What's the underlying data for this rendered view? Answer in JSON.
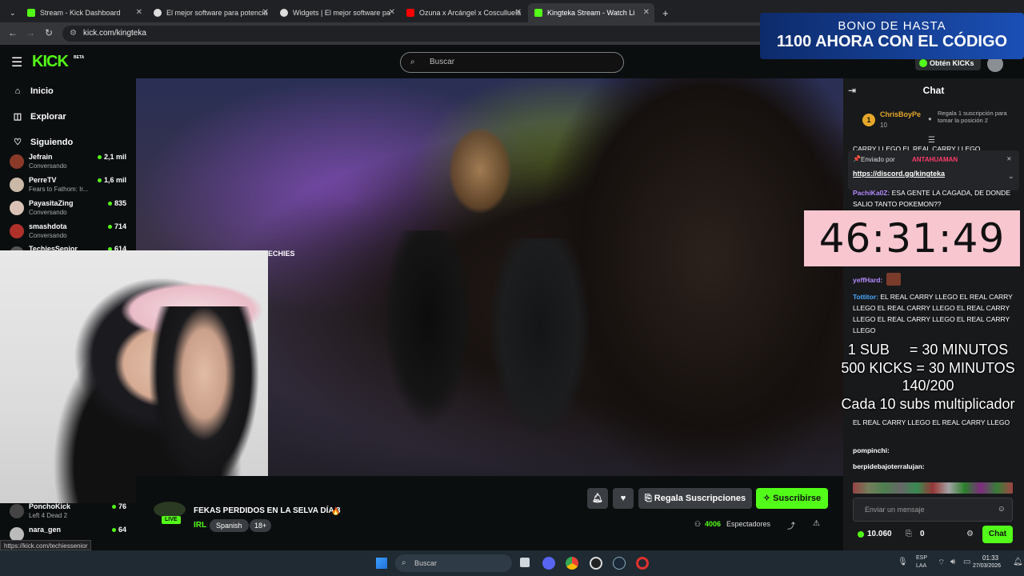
{
  "browser": {
    "tabs": [
      {
        "title": "Stream - Kick Dashboard",
        "color": "#53fc18",
        "active": false
      },
      {
        "title": "El mejor software para potencia",
        "color": "#dddddd",
        "active": false
      },
      {
        "title": "Widgets | El mejor software pa",
        "color": "#dddddd",
        "active": false
      },
      {
        "title": "Ozuna x Arcángel x Cosculluela",
        "color": "#ff0000",
        "active": false
      },
      {
        "title": "Kingteka Stream - Watch Li",
        "color": "#53fc18",
        "active": true
      }
    ],
    "new_tab": "+",
    "url": "kick.com/kingteka",
    "status_url": "https://kick.com/techiessenior"
  },
  "ad": {
    "line1": "BONO DE HASTA",
    "line2": "1100 AHORA CON EL CÓDIGO"
  },
  "header": {
    "logo": "KICK",
    "logo_badge": "BETA",
    "search_placeholder": "Buscar",
    "get_kicks": "Obtén KICKs"
  },
  "sidebar": {
    "nav": [
      {
        "label": "Inicio",
        "icon": "home-icon"
      },
      {
        "label": "Explorar",
        "icon": "compass-icon"
      },
      {
        "label": "Siguiendo",
        "icon": "heart-icon"
      }
    ],
    "following": [
      {
        "name": "Jefrain",
        "status": "Conversando",
        "viewers": "2,1 mil"
      },
      {
        "name": "PerreTV",
        "status": "Fears to Fathom: Ir...",
        "viewers": "1,6 mil"
      },
      {
        "name": "PayasitaZing",
        "status": "Conversando",
        "viewers": "835"
      },
      {
        "name": "smashdota",
        "status": "Conversando",
        "viewers": "714"
      },
      {
        "name": "TechiesSenior",
        "status": "",
        "viewers": "614"
      }
    ],
    "following_bottom": [
      {
        "name": "PonchoKick",
        "status": "Left 4 Dead 2",
        "viewers": "76"
      },
      {
        "name": "nara_gen",
        "status": "",
        "viewers": "64"
      }
    ]
  },
  "stream": {
    "webcam_label": "ECHIES",
    "timer": "46:31:49",
    "overlay_lines": [
      "1 SUB     = 30 MINUTOS",
      "500 KICKS = 30 MINUTOS",
      "140/200",
      "Cada 10 subs multiplicador"
    ],
    "title": "FEKAS PERDIDOS EN LA SELVA DÍA 3",
    "live_badge": "LIVE",
    "category": "IRL",
    "tags": [
      "Spanish",
      "18+"
    ],
    "viewers": "4006",
    "viewers_label": "Espectadores",
    "gift_button": "Regala Suscripciones",
    "subscribe_button": "Suscribirse"
  },
  "chat": {
    "title": "Chat",
    "top_gifter": {
      "rank": "1",
      "name": "ChrisBoyPe",
      "count": "10",
      "prompt": "Regala 1 suscripción para tomar la posición 2"
    },
    "pinned": {
      "by_label": "Enviado por",
      "by_user": "ANTAHUAMAN",
      "link": "https://discord.gg/kingteka"
    },
    "messages": [
      {
        "user": "",
        "text": "CARRY LLEGO   EL REAL CARRY LLEGO",
        "color": "#ffffff"
      },
      {
        "user": "PachiKa0Z:",
        "text": "ESA GENTE LA CAGADA, DE DONDE SALIO TANTO POKEMON??",
        "color": "#b48cff"
      },
      {
        "user": "yeffHard:",
        "text": "",
        "color": "#b48cff"
      },
      {
        "user": "Tottitor:",
        "text": "EL REAL CARRY LLEGO  EL REAL CARRY LLEGO  EL REAL CARRY LLEGO  EL REAL CARRY LLEGO  EL REAL CARRY LLEGO  EL REAL CARRY LLEGO",
        "color": "#4aa8ff"
      },
      {
        "user": "",
        "text": "EL REAL CARRY LLEGO  EL REAL CARRY LLEGO",
        "color": "#ffffff"
      },
      {
        "user": "pompinchi:",
        "text": "",
        "color": "#ffffff"
      },
      {
        "user": "berpidebajoterralujan:",
        "text": "",
        "color": "#ffffff"
      }
    ],
    "input_placeholder": "Enviar un mensaje",
    "kicks_balance": "10.060",
    "gift_count": "0",
    "send_button": "Chat"
  },
  "taskbar": {
    "search_placeholder": "Buscar",
    "lang_top": "ESP",
    "lang_bottom": "LAA",
    "time": "01:33",
    "date": "27/03/2026"
  },
  "colors": {
    "kick_green": "#53fc18",
    "gift_gray": "#3a3d42",
    "chat_bg": "#18191b"
  }
}
